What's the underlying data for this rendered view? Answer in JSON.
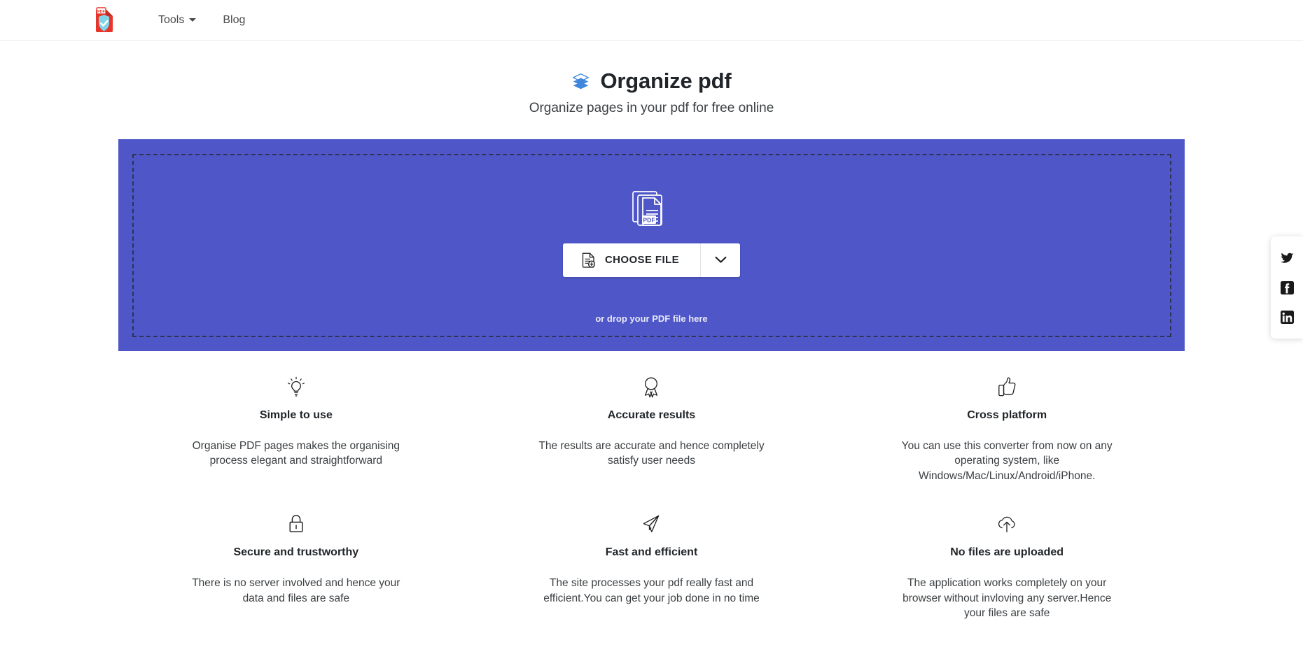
{
  "navbar": {
    "logo_icon": "pdf-shield-logo",
    "links": [
      {
        "label": "Tools",
        "icon": "chevron-down-icon",
        "has_dropdown": true
      },
      {
        "label": "Blog",
        "icon": "",
        "has_dropdown": false
      }
    ]
  },
  "hero": {
    "icon": "layers-icon",
    "title": "Organize pdf",
    "subtitle": "Organize pages in your pdf for free online"
  },
  "dropzone": {
    "icon": "pdf-documents-stack-icon",
    "choose_file_label": "CHOOSE FILE",
    "choose_file_icon": "document-add-icon",
    "dropdown_icon": "chevron-down-icon",
    "drop_hint": "or drop your PDF file here",
    "background_color": "#4f57c8",
    "border_style": "dashed",
    "border_color": "#2e3254"
  },
  "features": [
    {
      "icon": "lightbulb-icon",
      "title": "Simple to use",
      "description": "Organise PDF pages makes the organising process elegant and straightforward"
    },
    {
      "icon": "award-ribbon-icon",
      "title": "Accurate results",
      "description": "The results are accurate and hence completely satisfy user needs"
    },
    {
      "icon": "thumbs-up-icon",
      "title": "Cross platform",
      "description": "You can use this converter from now on any operating system, like Windows/Mac/Linux/Android/iPhone."
    },
    {
      "icon": "lock-icon",
      "title": "Secure and trustworthy",
      "description": "There is no server involved and hence your data and files are safe"
    },
    {
      "icon": "paper-plane-icon",
      "title": "Fast and efficient",
      "description": "The site processes your pdf really fast and efficient.You can get your job done in no time"
    },
    {
      "icon": "cloud-upload-icon",
      "title": "No files are uploaded",
      "description": "The application works completely on your browser without invloving any server.Hence your files are safe"
    }
  ],
  "social_rail": [
    {
      "icon": "twitter-icon",
      "name": "Twitter"
    },
    {
      "icon": "facebook-icon",
      "name": "Facebook"
    },
    {
      "icon": "linkedin-icon",
      "name": "LinkedIn"
    }
  ]
}
